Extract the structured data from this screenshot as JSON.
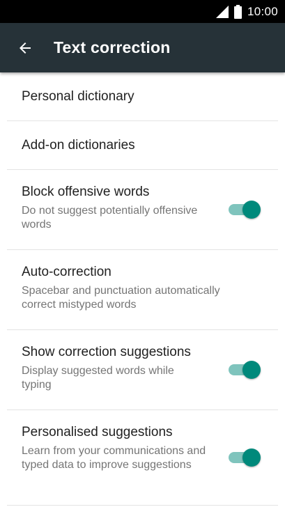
{
  "status_bar": {
    "time": "10:00",
    "icons": [
      "cellular-signal-icon",
      "battery-icon"
    ]
  },
  "app_bar": {
    "title": "Text correction",
    "back_icon": "arrow-back-icon"
  },
  "colors": {
    "app_bar": "#263238",
    "toggle_on_thumb": "#00897b",
    "toggle_on_track": "#7fc4bd"
  },
  "settings": [
    {
      "title": "Personal dictionary"
    },
    {
      "title": "Add-on dictionaries"
    },
    {
      "title": "Block offensive words",
      "summary": "Do not suggest potentially offensive words",
      "toggle": true
    },
    {
      "title": "Auto-correction",
      "summary": "Spacebar and punctuation automatically correct mistyped words"
    },
    {
      "title": "Show correction suggestions",
      "summary": "Display suggested words while typing",
      "toggle": true
    },
    {
      "title": "Personalised suggestions",
      "summary": "Learn from your communications and typed data to improve suggestions",
      "toggle": true
    }
  ]
}
